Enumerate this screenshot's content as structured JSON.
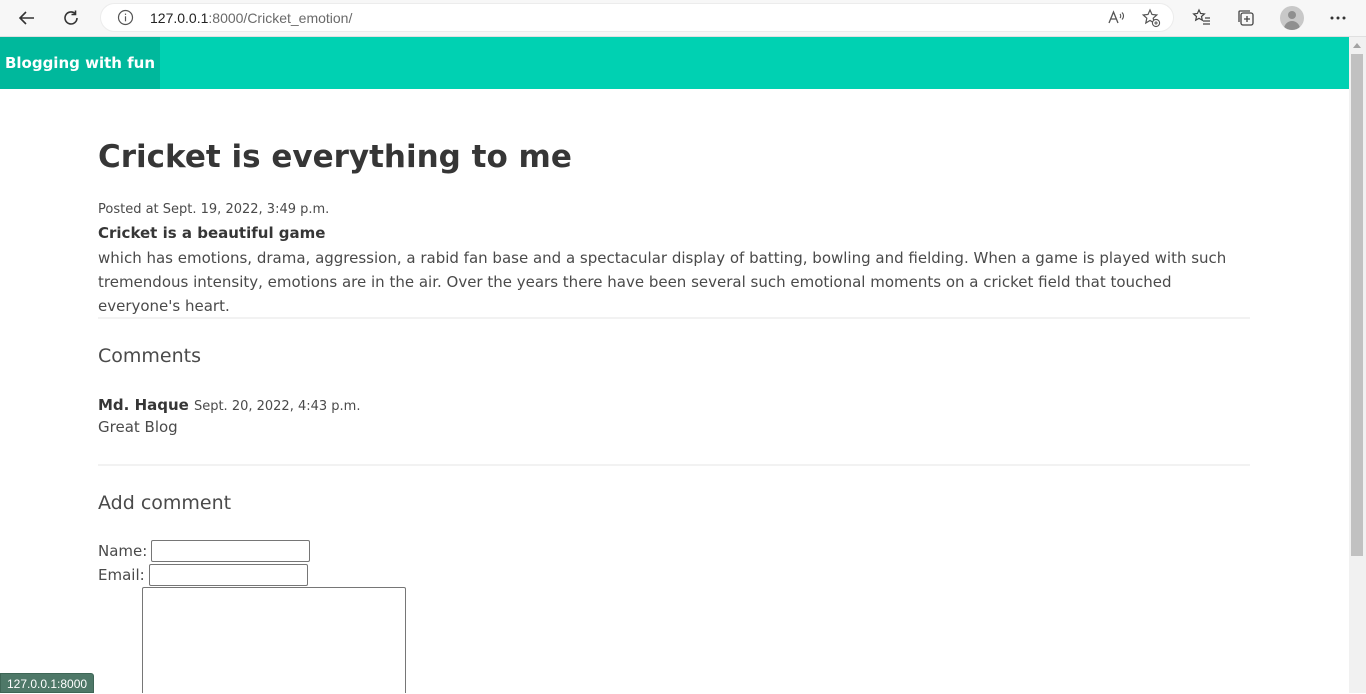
{
  "browser": {
    "url_host": "127.0.0.1",
    "url_rest": ":8000/Cricket_emotion/",
    "status_url": "127.0.0.1:8000"
  },
  "navbar": {
    "brand": "Blogging with fun"
  },
  "post": {
    "title": "Cricket is everything to me",
    "posted": "Posted at Sept. 19, 2022, 3:49 p.m.",
    "intro": "Cricket is a beautiful game",
    "body": "which has emotions, drama, aggression, a rabid fan base and a spectacular display of batting, bowling and fielding. When a game is played with such tremendous intensity, emotions are in the air. Over the years there have been several such emotional moments on a cricket field that touched everyone's heart."
  },
  "comments": {
    "heading": "Comments",
    "items": [
      {
        "author": "Md. Haque",
        "date": "Sept. 20, 2022, 4:43 p.m.",
        "text": "Great Blog"
      }
    ]
  },
  "form": {
    "heading": "Add comment",
    "name_label": "Name:",
    "email_label": "Email:"
  }
}
